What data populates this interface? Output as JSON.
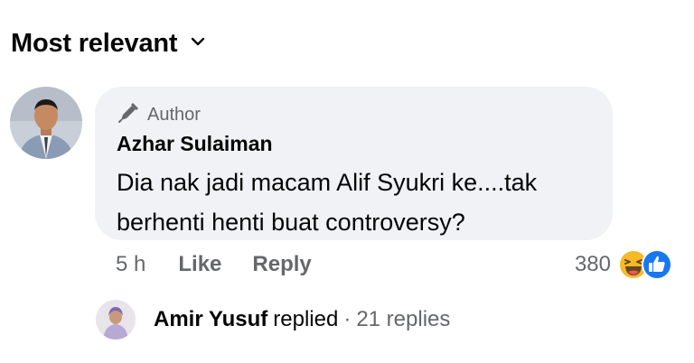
{
  "sort": {
    "label": "Most relevant",
    "icon": "chevron-down-icon"
  },
  "comment": {
    "badge": "Author",
    "badge_icon": "pen-icon",
    "author": "Azhar Sulaiman",
    "text": "Dia nak jadi macam Alif Syukri ke....tak berhenti henti buat controversy?",
    "time": "5 h",
    "like_label": "Like",
    "reply_label": "Reply",
    "reaction_count": "380",
    "reaction_icons": [
      "haha-icon",
      "like-icon"
    ]
  },
  "replies": {
    "replier": "Amir Yusuf",
    "verb": "replied",
    "separator": "·",
    "count_label": "21 replies"
  },
  "colors": {
    "bubble": "#f0f2f5",
    "secondary_text": "#65676b",
    "like_blue": "#1877f2",
    "haha_yellow": "#f7b928"
  }
}
